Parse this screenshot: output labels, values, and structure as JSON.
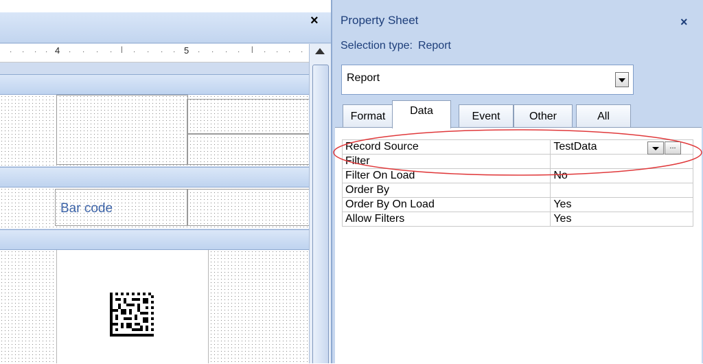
{
  "design": {
    "close_glyph": "×",
    "ruler_numbers": [
      "4",
      "5"
    ],
    "barcode_label": "Bar code"
  },
  "property_sheet": {
    "title": "Property Sheet",
    "close_glyph": "×",
    "selection_type_label": "Selection type:",
    "selection_type_value": "Report",
    "object_select_value": "Report",
    "tabs": [
      "Format",
      "Data",
      "Event",
      "Other",
      "All"
    ],
    "active_tab": "Data",
    "properties": [
      {
        "name": "Record Source",
        "value": "TestData"
      },
      {
        "name": "Filter",
        "value": ""
      },
      {
        "name": "Filter On Load",
        "value": "No"
      },
      {
        "name": "Order By",
        "value": ""
      },
      {
        "name": "Order By On Load",
        "value": "Yes"
      },
      {
        "name": "Allow Filters",
        "value": "Yes"
      }
    ],
    "builder_button_glyph": "...",
    "highlight_color": "#e0383a"
  }
}
